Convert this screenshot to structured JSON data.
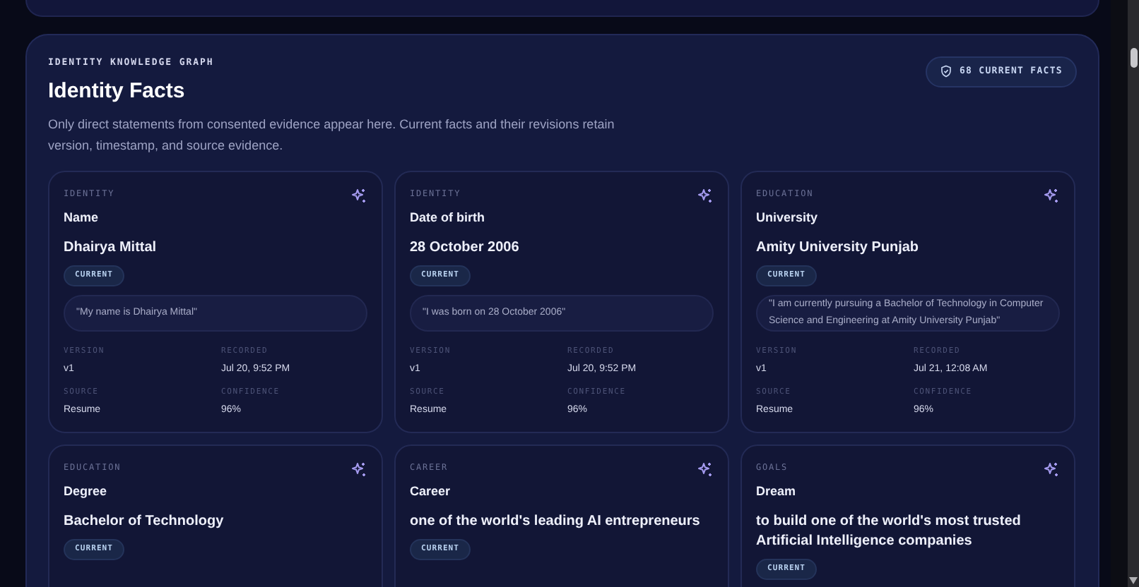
{
  "section": {
    "kicker": "IDENTITY KNOWLEDGE GRAPH",
    "title": "Identity Facts",
    "description": "Only direct statements from consented evidence appear here. Current facts and their revisions retain version, timestamp, and source evidence.",
    "badge": "68 CURRENT FACTS"
  },
  "facts": [
    {
      "category": "IDENTITY",
      "label": "Name",
      "value": "Dhairya Mittal",
      "status": "CURRENT",
      "quote": "\"My name is Dhairya Mittal\"",
      "meta": [
        {
          "label": "VERSION",
          "value": "v1"
        },
        {
          "label": "RECORDED",
          "value": "Jul 20, 9:52 PM"
        },
        {
          "label": "SOURCE",
          "value": "Resume"
        },
        {
          "label": "CONFIDENCE",
          "value": "96%"
        }
      ]
    },
    {
      "category": "IDENTITY",
      "label": "Date of birth",
      "value": "28 October 2006",
      "status": "CURRENT",
      "quote": "\"I was born on 28 October 2006\"",
      "meta": [
        {
          "label": "VERSION",
          "value": "v1"
        },
        {
          "label": "RECORDED",
          "value": "Jul 20, 9:52 PM"
        },
        {
          "label": "SOURCE",
          "value": "Resume"
        },
        {
          "label": "CONFIDENCE",
          "value": "96%"
        }
      ]
    },
    {
      "category": "EDUCATION",
      "label": "University",
      "value": "Amity University Punjab",
      "status": "CURRENT",
      "quote": "\"I am currently pursuing a Bachelor of Technology in Computer Science and Engineering at Amity University Punjab\"",
      "meta": [
        {
          "label": "VERSION",
          "value": "v1"
        },
        {
          "label": "RECORDED",
          "value": "Jul 21, 12:08 AM"
        },
        {
          "label": "SOURCE",
          "value": "Resume"
        },
        {
          "label": "CONFIDENCE",
          "value": "96%"
        }
      ]
    },
    {
      "category": "EDUCATION",
      "label": "Degree",
      "value": "Bachelor of Technology",
      "status": "CURRENT"
    },
    {
      "category": "CAREER",
      "label": "Career",
      "value": "one of the world's leading AI entrepreneurs",
      "status": "CURRENT"
    },
    {
      "category": "GOALS",
      "label": "Dream",
      "value": "to build one of the world's most trusted Artificial Intelligence companies",
      "status": "CURRENT"
    }
  ]
}
